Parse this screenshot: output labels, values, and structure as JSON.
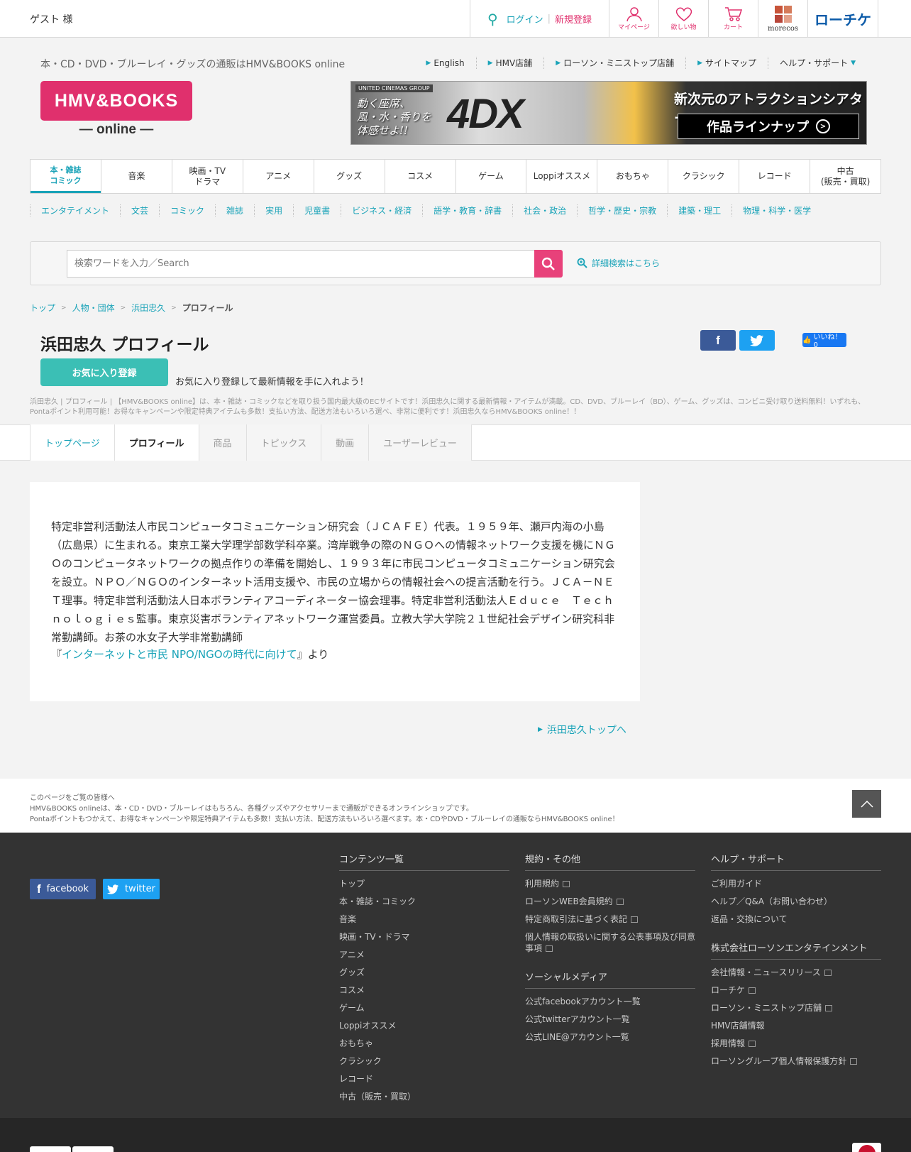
{
  "topbar": {
    "guest": "ゲスト 様",
    "login": "ログイン",
    "register": "新規登録",
    "icons": [
      {
        "label": "マイページ",
        "icon": "person-icon"
      },
      {
        "label": "欲しい物",
        "icon": "heart-icon"
      },
      {
        "label": "カート",
        "icon": "cart-icon"
      }
    ],
    "moreco": "morecos",
    "lticket": "ローチケ"
  },
  "header": {
    "tagline": "本・CD・DVD・ブルーレイ・グッズの通販はHMV&BOOKS online",
    "links": [
      "English",
      "HMV店舗",
      "ローソン・ミニストップ店舗",
      "サイトマップ"
    ],
    "help": "ヘルプ・サポート",
    "logo_main": "HMV&BOOKS",
    "logo_sub": "— online —"
  },
  "banner": {
    "brand": "UNITED CINEMAS GROUP",
    "left": [
      "動く座席、",
      "風・水・香りを",
      "体感せよ!!"
    ],
    "mark": "4DX",
    "title": "新次元のアトラクションシアター",
    "button": "作品ラインナップ"
  },
  "mainnav": [
    [
      "本・雑誌",
      "コミック"
    ],
    [
      "音楽"
    ],
    [
      "映画・TV",
      "ドラマ"
    ],
    [
      "アニメ"
    ],
    [
      "グッズ"
    ],
    [
      "コスメ"
    ],
    [
      "ゲーム"
    ],
    [
      "Loppiオススメ"
    ],
    [
      "おもちゃ"
    ],
    [
      "クラシック"
    ],
    [
      "レコード"
    ],
    [
      "中古",
      "(販売・買取)"
    ]
  ],
  "subnav": [
    "エンタテイメント",
    "文芸",
    "コミック",
    "雑誌",
    "実用",
    "児童書",
    "ビジネス・経済",
    "語学・教育・辞書",
    "社会・政治",
    "哲学・歴史・宗教",
    "建築・理工",
    "物理・科学・医学"
  ],
  "search": {
    "placeholder": "検索ワードを入力／Search",
    "advanced": "詳細検索はこちら"
  },
  "breadcrumb": [
    "トップ",
    "人物・団体",
    "浜田忠久",
    "プロフィール"
  ],
  "page": {
    "title": "浜田忠久 プロフィール",
    "fav_button": "お気に入り登録",
    "fav_note": "お気に入り登録して最新情報を手に入れよう！",
    "like": "いいね！ 0",
    "description": "浜田忠久 | プロフィール | 【HMV&BOOKS online】は、本・雑誌・コミックなどを取り扱う国内最大級のECサイトです！浜田忠久に関する最新情報・アイテムが満載。CD、DVD、ブルーレイ（BD）、ゲーム、グッズは、コンビニ受け取り送料無料！いずれも、Pontaポイント利用可能！お得なキャンペーンや限定特典アイテムも多数！支払い方法、配送方法もいろいろ選べ、非常に便利です！浜田忠久ならHMV&BOOKS online！！"
  },
  "tabs": [
    {
      "label": "トップページ",
      "state": "link"
    },
    {
      "label": "プロフィール",
      "state": "active"
    },
    {
      "label": "商品",
      "state": "disabled"
    },
    {
      "label": "トピックス",
      "state": "disabled"
    },
    {
      "label": "動画",
      "state": "disabled"
    },
    {
      "label": "ユーザーレビュー",
      "state": "disabled"
    }
  ],
  "bio": {
    "text": "特定非営利活動法人市民コンピュータコミュニケーション研究会（ＪＣＡＦＥ）代表。１９５９年、瀬戸内海の小島（広島県）に生まれる。東京工業大学理学部数学科卒業。湾岸戦争の際のＮＧＯへの情報ネットワーク支援を機にＮＧＯのコンピュータネットワークの拠点作りの準備を開始し、１９９３年に市民コンピュータコミュニケーション研究会を設立。ＮＰＯ／ＮＧＯのインターネット活用支援や、市民の立場からの情報社会への提言活動を行う。ＪＣＡ－ＮＥＴ理事。特定非営利活動法人日本ボランティアコーディネーター協会理事。特定非営利活動法人Ｅｄｕｃｅ　Ｔｅｃｈｎｏｌｏｇｉｅｓ監事。東京災害ボランティアネットワーク運営委員。立教大学大学院２１世紀社会デザイン研究科非常勤講師。お茶の水女子大学非常勤講師",
    "src_open": "『",
    "src_link": "インターネットと市民 NPO/NGOの時代に向けて",
    "src_close": "』より",
    "top_link": "浜田忠久トップへ"
  },
  "prefooter": [
    "このページをご覧の皆様へ",
    "HMV&BOOKS onlineは、本・CD・DVD・ブルーレイはもちろん、各種グッズやアクセサリーまで通販ができるオンラインショップです。",
    "Pontaポイントもつかえて、お得なキャンペーンや限定特典アイテムも多数！支払い方法、配送方法もいろいろ選べます。本・CDやDVD・ブルーレイの通販ならHMV&BOOKS online！"
  ],
  "footer": {
    "facebook": "facebook",
    "twitter": "twitter",
    "contents_title": "コンテンツ一覧",
    "contents": [
      "トップ",
      "本・雑誌・コミック",
      "音楽",
      "映画・TV・ドラマ",
      "アニメ",
      "グッズ",
      "コスメ",
      "ゲーム",
      "Loppiオススメ",
      "おもちゃ",
      "クラシック",
      "レコード",
      "中古（販売・買取）"
    ],
    "terms_title": "規約・その他",
    "terms": [
      "利用規約",
      "ローソンWEB会員規約",
      "特定商取引法に基づく表記",
      "個人情報の取扱いに関する公表事項及び同意事項"
    ],
    "social_title": "ソーシャルメディア",
    "social": [
      "公式facebookアカウント一覧",
      "公式twitterアカウント一覧",
      "公式LINE@アカウント一覧"
    ],
    "help_title": "ヘルプ・サポート",
    "help": [
      "ご利用ガイド",
      "ヘルプ／Q&A（お問い合わせ）",
      "返品・交換について"
    ],
    "company_title": "株式会社ローソンエンタテインメント",
    "company": [
      "会社情報・ニュースリリース",
      "ローチケ",
      "ローソン・ミニストップ店舗",
      "HMV店舗情報",
      "採用情報",
      "ローソングループ個人情報保護方針"
    ]
  }
}
